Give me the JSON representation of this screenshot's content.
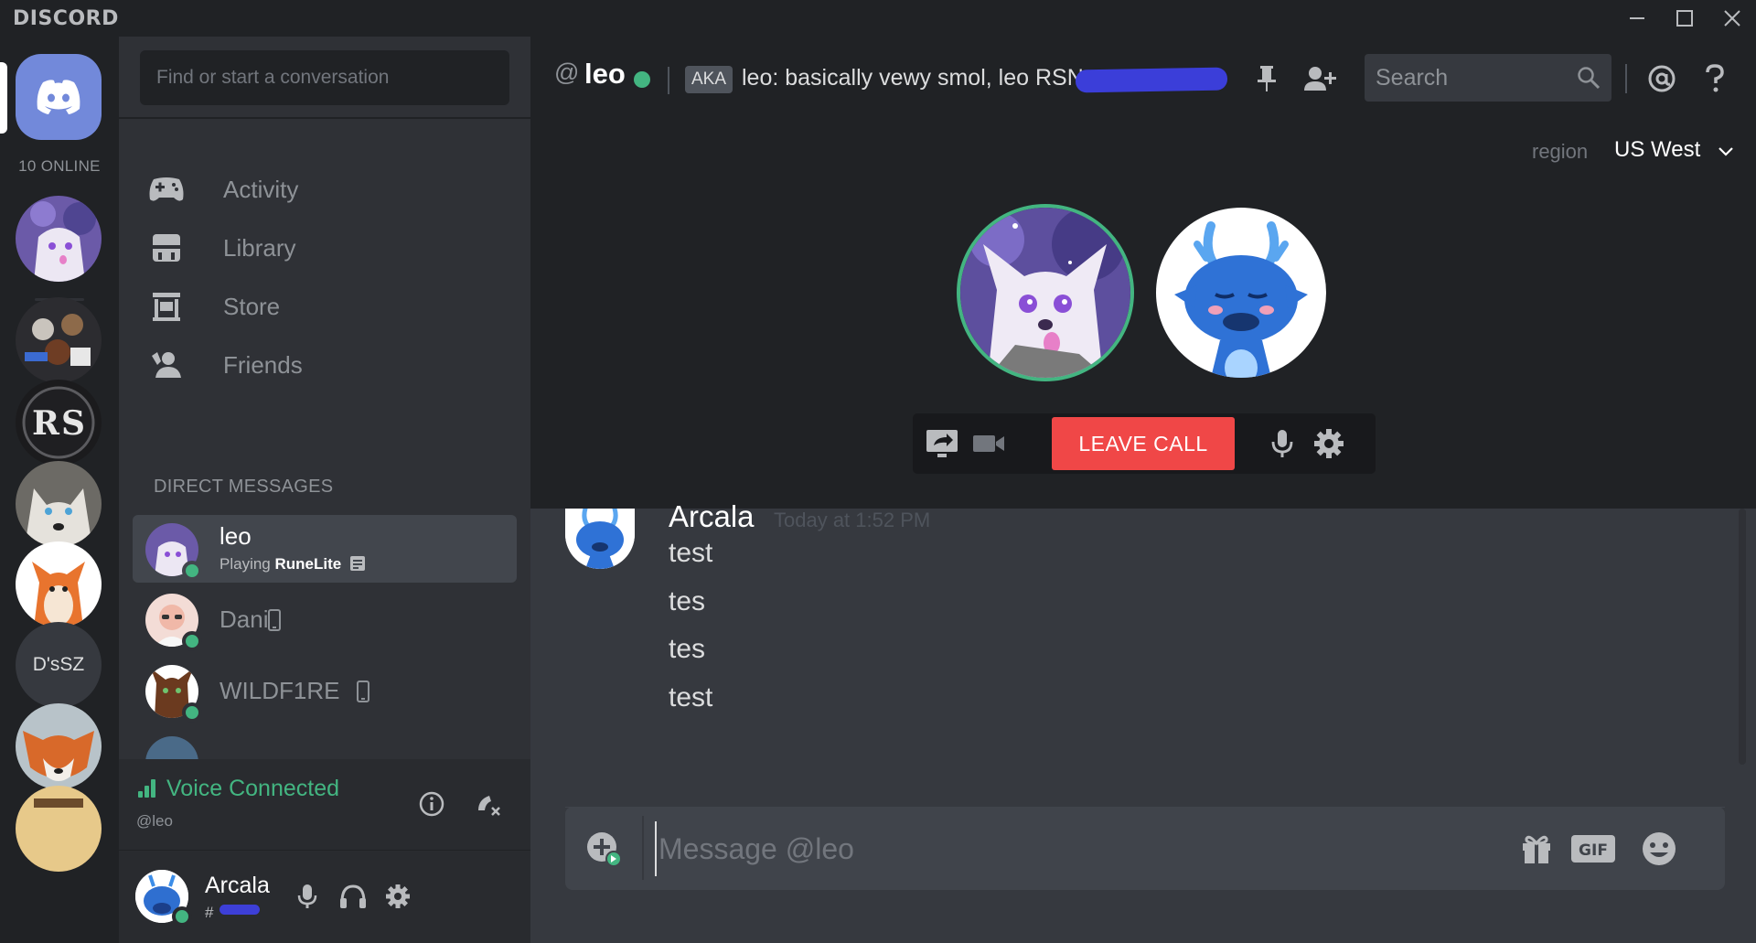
{
  "app": {
    "brand": "DISCORD"
  },
  "window": {
    "minimize": "—",
    "maximize": "☐",
    "close": "✕"
  },
  "rail": {
    "online_count": "10 ONLINE",
    "text_server_label": "D'sSZ"
  },
  "dm_column": {
    "search_placeholder": "Find or start a conversation",
    "nav": [
      {
        "label": "Activity",
        "icon": "gamepad-icon"
      },
      {
        "label": "Library",
        "icon": "library-icon"
      },
      {
        "label": "Store",
        "icon": "store-icon"
      },
      {
        "label": "Friends",
        "icon": "friends-icon"
      }
    ],
    "section_header": "DIRECT MESSAGES",
    "dms": [
      {
        "name": "leo",
        "activity_prefix": "Playing",
        "activity_game": "RuneLite",
        "status": "online",
        "active": true
      },
      {
        "name": "Dani",
        "status": "online",
        "mobile": true
      },
      {
        "name": "WILDF1RE",
        "status": "online",
        "mobile": true
      }
    ]
  },
  "voice": {
    "title": "Voice Connected",
    "subtitle": "@leo"
  },
  "user": {
    "name": "Arcala",
    "tag_prefix": "#"
  },
  "header": {
    "at": "@",
    "name": "leo",
    "aka_badge": "AKA",
    "topic": "leo: basically vewy smol, leo RSN:",
    "search_placeholder": "Search"
  },
  "call": {
    "region_label": "region",
    "region_value": "US West",
    "leave_label": "LEAVE CALL"
  },
  "messages": {
    "author": "Arcala",
    "timestamp": "Today at 1:52 PM",
    "lines": [
      "test",
      "tes",
      "tes",
      "test"
    ]
  },
  "composer": {
    "placeholder": "Message @leo",
    "gif_label": "GIF"
  },
  "colors": {
    "blurple": "#7289da",
    "online_green": "#43b581",
    "danger_red": "#f04747"
  }
}
